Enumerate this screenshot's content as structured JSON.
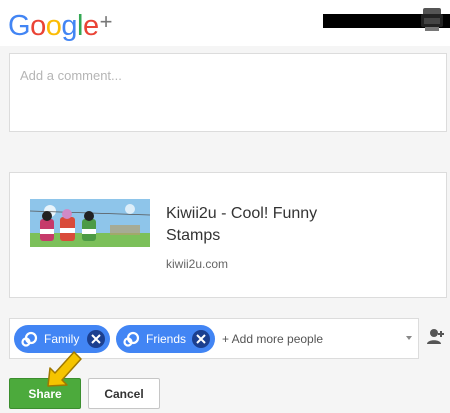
{
  "header": {
    "logo_text": "Google",
    "logo_plus": "+",
    "logo_colors": [
      "#4285f4",
      "#ea4335",
      "#fbbc05",
      "#4285f4",
      "#34a853",
      "#ea4335"
    ]
  },
  "comment": {
    "placeholder": "Add a comment..."
  },
  "link_preview": {
    "title": "Kiwii2u - Cool! Funny Stamps",
    "domain": "kiwii2u.com"
  },
  "share_with": {
    "chips": [
      {
        "label": "Family",
        "icon": "circles-icon"
      },
      {
        "label": "Friends",
        "icon": "circles-icon"
      }
    ],
    "add_more_label": "+ Add more people"
  },
  "actions": {
    "share_label": "Share",
    "cancel_label": "Cancel"
  },
  "colors": {
    "chip": "#4285f4",
    "share_button": "#4caa3c",
    "arrow": "#f5c400"
  }
}
